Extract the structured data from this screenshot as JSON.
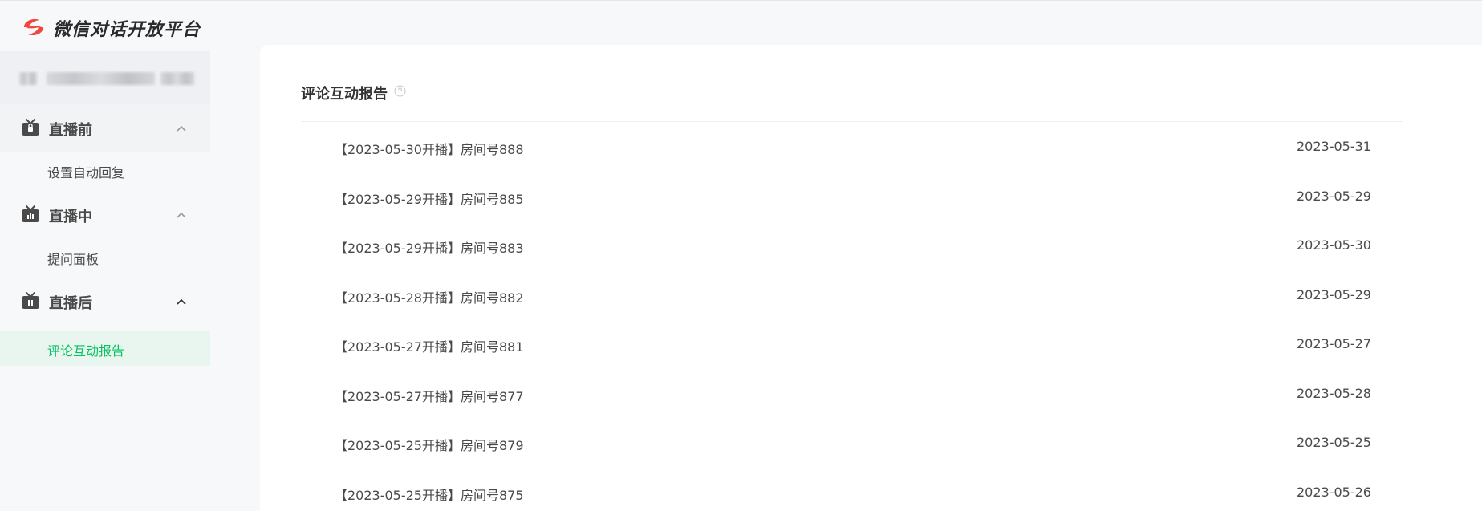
{
  "header": {
    "brand": "微信对话开放平台",
    "logo_icon": "wechat-dialog-logo-icon",
    "logo_color": "#f2453d"
  },
  "sidebar": {
    "groups": [
      {
        "label": "直播前",
        "icon": "tv-lock-icon",
        "expanded": true,
        "items": [
          {
            "label": "设置自动回复",
            "active": false
          }
        ]
      },
      {
        "label": "直播中",
        "icon": "tv-chart-icon",
        "expanded": true,
        "items": [
          {
            "label": "提问面板",
            "active": false
          }
        ]
      },
      {
        "label": "直播后",
        "icon": "tv-pause-icon",
        "expanded": true,
        "items": [
          {
            "label": "评论互动报告",
            "active": true
          }
        ]
      }
    ],
    "active_color": "#07c160"
  },
  "main": {
    "title": "评论互动报告",
    "help_icon": "question-circle-icon",
    "rows": [
      {
        "name": "【2023-05-30开播】房间号888",
        "date": "2023-05-31"
      },
      {
        "name": "【2023-05-29开播】房间号885",
        "date": "2023-05-29"
      },
      {
        "name": "【2023-05-29开播】房间号883",
        "date": "2023-05-30"
      },
      {
        "name": "【2023-05-28开播】房间号882",
        "date": "2023-05-29"
      },
      {
        "name": "【2023-05-27开播】房间号881",
        "date": "2023-05-27"
      },
      {
        "name": "【2023-05-27开播】房间号877",
        "date": "2023-05-28"
      },
      {
        "name": "【2023-05-25开播】房间号879",
        "date": "2023-05-25"
      },
      {
        "name": "【2023-05-25开播】房间号875",
        "date": "2023-05-26"
      }
    ]
  }
}
